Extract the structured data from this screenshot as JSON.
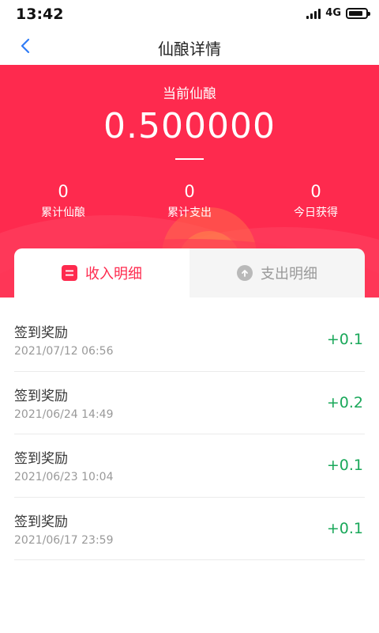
{
  "status": {
    "time": "13:42",
    "network": "4G",
    "battery_level": 0.85
  },
  "nav": {
    "title": "仙酿详情",
    "back_icon": "chevron-left-icon"
  },
  "summary": {
    "balance_label": "当前仙酿",
    "balance_value": "0.500000",
    "stats": [
      {
        "value": "0",
        "label": "累计仙酿"
      },
      {
        "value": "0",
        "label": "累计支出"
      },
      {
        "value": "0",
        "label": "今日获得"
      }
    ]
  },
  "tabs": [
    {
      "label": "收入明细",
      "icon": "list-icon",
      "active": true
    },
    {
      "label": "支出明细",
      "icon": "arrow-up-circle-icon",
      "active": false
    }
  ],
  "records": [
    {
      "title": "签到奖励",
      "time": "2021/07/12 06:56",
      "amount": "+0.1"
    },
    {
      "title": "签到奖励",
      "time": "2021/06/24 14:49",
      "amount": "+0.2"
    },
    {
      "title": "签到奖励",
      "time": "2021/06/23 10:04",
      "amount": "+0.1"
    },
    {
      "title": "签到奖励",
      "time": "2021/06/17 23:59",
      "amount": "+0.1"
    }
  ],
  "colors": {
    "primary": "#fe2a4e",
    "income_amount": "#1aa85a",
    "back_icon": "#2f7cf6"
  }
}
